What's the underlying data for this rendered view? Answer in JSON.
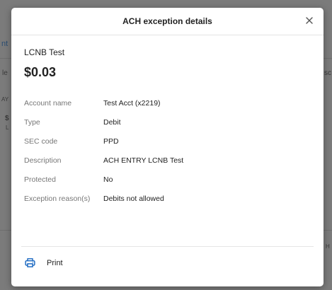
{
  "background": {
    "fragments": [
      "nt",
      "le",
      "AY",
      "$",
      "L",
      "sc",
      "H"
    ]
  },
  "modal": {
    "title": "ACH exception details",
    "close_glyph": "×",
    "payee": "LCNB Test",
    "amount": "$0.03",
    "details": [
      {
        "label": "Account name",
        "value": "Test Acct (x2219)"
      },
      {
        "label": "Type",
        "value": "Debit"
      },
      {
        "label": "SEC code",
        "value": "PPD"
      },
      {
        "label": "Description",
        "value": "ACH ENTRY LCNB Test"
      },
      {
        "label": "Protected",
        "value": "No"
      },
      {
        "label": "Exception reason(s)",
        "value": "Debits not allowed"
      }
    ],
    "print_label": "Print",
    "print_icon": "printer-icon"
  },
  "colors": {
    "accent": "#1565c0",
    "backdrop": "#7b7b7b",
    "modal_bg": "#ffffff",
    "label_text": "#777777",
    "value_text": "#222222"
  }
}
